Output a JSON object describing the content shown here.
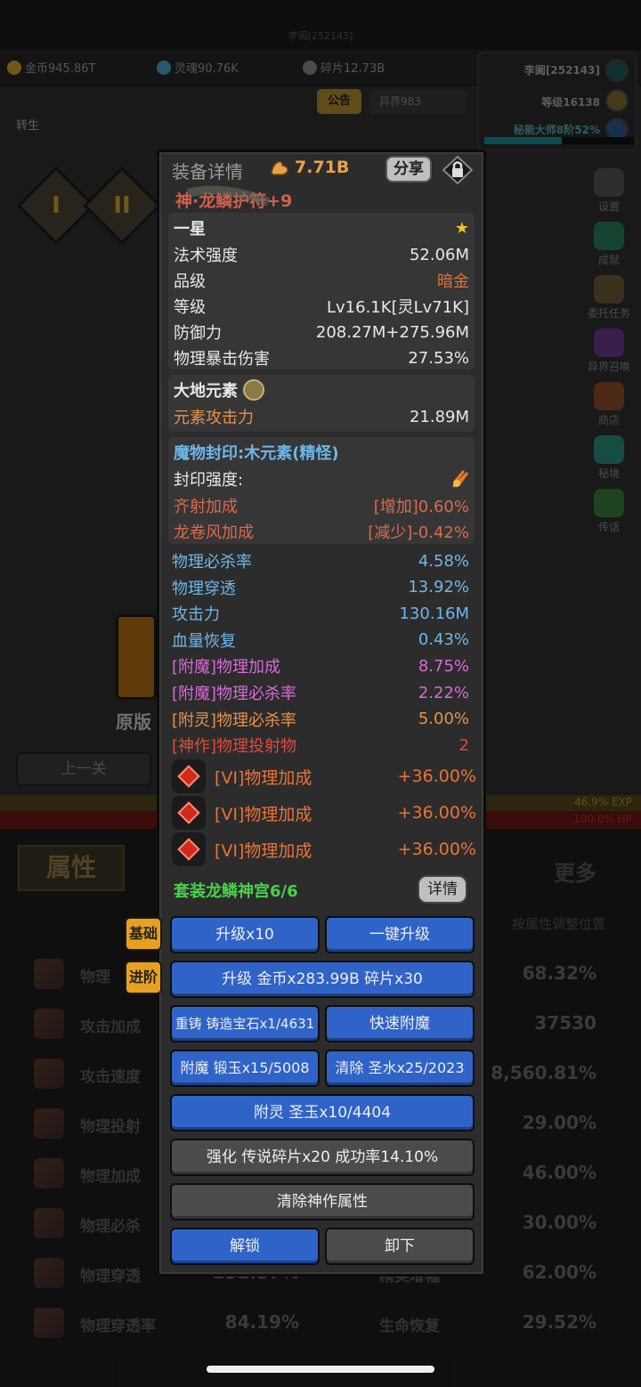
{
  "topbar": {
    "player_id": "李阖[252143]"
  },
  "resources": [
    {
      "label": "金币945.86T",
      "color": "#c9a32a"
    },
    {
      "label": "灵魂90.76K",
      "color": "#4aa0c8"
    },
    {
      "label": "碎片12.73B",
      "color": "#888888"
    }
  ],
  "profile": {
    "name": "李阖[252143]",
    "level": "等级16138",
    "mastery": "秘能大师8阶52%",
    "mastery_progress": 0.52
  },
  "buttons_top": {
    "notice": "公告",
    "otherworld": "异界983"
  },
  "left": {
    "rebirth": "转生",
    "roman1": "I",
    "roman2": "II",
    "prev_level": "上一关",
    "original": "原版"
  },
  "side_menu": [
    {
      "label": "设置",
      "icon": "gear-icon",
      "color": "#555555"
    },
    {
      "label": "成就",
      "icon": "star-icon",
      "color": "#2a7a5a"
    },
    {
      "label": "委托任务",
      "icon": "scroll-icon",
      "color": "#6a5a3a"
    },
    {
      "label": "异界召唤",
      "icon": "portal-icon",
      "color": "#6a3a8a"
    },
    {
      "label": "商店",
      "icon": "pot-icon",
      "color": "#8a4a2a"
    },
    {
      "label": "秘境",
      "icon": "vortex-icon",
      "color": "#2a8a7a"
    },
    {
      "label": "传话",
      "icon": "horn-icon",
      "color": "#3a7a3a"
    }
  ],
  "strips": {
    "exp": "46.9% EXP",
    "hp": "100.0% HP"
  },
  "lower": {
    "tab_attr": "属性",
    "tab_more": "更多",
    "sort_hint": "按属性调整位置",
    "stats_left": [
      {
        "label": "物理",
        "value": ""
      },
      {
        "label": "攻击加成",
        "value": ""
      },
      {
        "label": "攻击速度",
        "value": ""
      },
      {
        "label": "物理投射",
        "value": ""
      },
      {
        "label": "物理加成",
        "value": ""
      },
      {
        "label": "物理必杀",
        "value": ""
      },
      {
        "label": "物理穿透",
        "value": "232.37%"
      },
      {
        "label": "物理穿透率",
        "value": "84.19%"
      }
    ],
    "stats_right": [
      {
        "label": "",
        "value": "68.32%"
      },
      {
        "label": "",
        "value": "37530"
      },
      {
        "label": "",
        "value": "8,560.81%"
      },
      {
        "label": "",
        "value": "29.00%"
      },
      {
        "label": "",
        "value": "46.00%"
      },
      {
        "label": "",
        "value": "30.00%"
      },
      {
        "label": "精英增幅",
        "value": "62.00%"
      },
      {
        "label": "生命恢复",
        "value": "29.52%"
      }
    ]
  },
  "dialog": {
    "title": "装备详情",
    "power": "7.71B",
    "share": "分享",
    "item_name": "神·龙鳞护符+9",
    "star_header": "一星",
    "base_stats": [
      {
        "k": "法术强度",
        "v": "52.06M"
      },
      {
        "k": "品级",
        "v": "暗金"
      },
      {
        "k": "等级",
        "v": "Lv16.1K[灵Lv71K]"
      },
      {
        "k": "防御力",
        "v": "208.27M+275.96M"
      },
      {
        "k": "物理暴击伤害",
        "v": "27.53%"
      }
    ],
    "element_header": "大地元素",
    "element_stat": {
      "k": "元素攻击力",
      "v": "21.89M"
    },
    "seal_header": "魔物封印:木元素(精怪)",
    "seal_strength_label": "封印强度:",
    "seal_stats": [
      {
        "k": "齐射加成",
        "v": "[增加]0.60%"
      },
      {
        "k": "龙卷风加成",
        "v": "[减少]-0.42%"
      }
    ],
    "blue_stats": [
      {
        "k": "物理必杀率",
        "v": "4.58%"
      },
      {
        "k": "物理穿透",
        "v": "13.92%"
      },
      {
        "k": "攻击力",
        "v": "130.16M"
      },
      {
        "k": "血量恢复",
        "v": "0.43%"
      }
    ],
    "enchant_stats": [
      {
        "k": "[附魔]物理加成",
        "v": "8.75%",
        "cls": "pink"
      },
      {
        "k": "[附魔]物理必杀率",
        "v": "2.22%",
        "cls": "pink"
      },
      {
        "k": "[附灵]物理必杀率",
        "v": "5.00%",
        "cls": "orange"
      },
      {
        "k": "[神作]物理投射物",
        "v": "2",
        "cls": "red"
      }
    ],
    "gems": [
      {
        "k": "[VI]物理加成",
        "v": "+36.00%"
      },
      {
        "k": "[VI]物理加成",
        "v": "+36.00%"
      },
      {
        "k": "[VI]物理加成",
        "v": "+36.00%"
      }
    ],
    "set_line": "套装龙鳞神宫6/6",
    "detail": "详情",
    "tags": {
      "basic": "基础",
      "advanced": "进阶"
    },
    "actions": {
      "upgrade10": "升级x10",
      "one_click": "一键升级",
      "upgrade_cost": "升级 金币x283.99B 碎片x30",
      "recast": "重铸 铸造宝石x1/4631",
      "quick_enchant": "快速附魔",
      "enchant": "附魔 锻玉x15/5008",
      "clear_holy": "清除 圣水x25/2023",
      "spirit": "附灵 圣玉x10/4404",
      "strengthen": "强化 传说碎片x20 成功率14.10%",
      "clear_divine": "清除神作属性",
      "unlock": "解锁",
      "unequip": "卸下"
    }
  }
}
